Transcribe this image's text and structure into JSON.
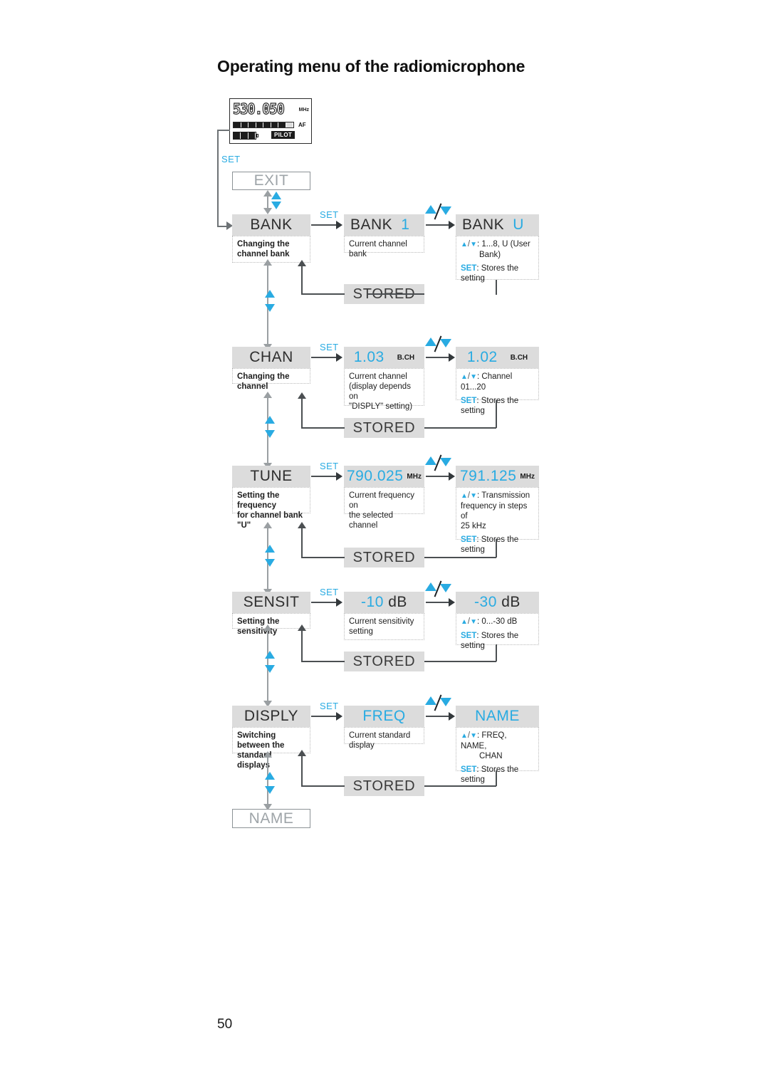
{
  "document": {
    "title": "Operating menu of the radiomicrophone",
    "page_number": "50"
  },
  "lcd": {
    "frequency": "530.050",
    "unit": "MHz",
    "af_label": "AF",
    "af_segments_on": 7,
    "af_segments_total": 8,
    "battery_segments_on": 3,
    "battery_segments_total": 3,
    "pilot_label": "PILOT"
  },
  "labels": {
    "set": "SET",
    "stored": "STORED",
    "exit": "EXIT",
    "name_bottom": "NAME"
  },
  "rows": [
    {
      "id": "bank",
      "menu_label": "BANK",
      "menu_desc": "Changing the channel bank",
      "value_label": "BANK",
      "value_number": "1",
      "value_desc": "Current channel bank",
      "edit_label": "BANK",
      "edit_number": "U",
      "edit_range_line1": ": 1...8, U (User",
      "edit_range_line2": "Bank)",
      "edit_set_label": "SET",
      "edit_set_text": ": Stores the setting",
      "stored": "STORED"
    },
    {
      "id": "chan",
      "menu_label": "CHAN",
      "menu_desc": "Changing the channel",
      "value_label": "1.03",
      "value_unit": "B.CH",
      "value_desc_l1": "Current channel",
      "value_desc_l2": "(display depends on",
      "value_desc_l3": "\"DISPLY\" setting)",
      "edit_label": "1.02",
      "edit_unit": "B.CH",
      "edit_range_line1": ": Channel  01...20",
      "edit_set_label": "SET",
      "edit_set_text": ": Stores the setting",
      "stored": "STORED"
    },
    {
      "id": "tune",
      "menu_label": "TUNE",
      "menu_desc_l1": "Setting the frequency",
      "menu_desc_l2": "for channel bank \"U\"",
      "value_label": "790.025",
      "value_unit": "MHz",
      "value_desc_l1": "Current frequency on",
      "value_desc_l2": "the selected channel",
      "edit_label": "791.125",
      "edit_unit": "MHz",
      "edit_range_line1": ": Transmission",
      "edit_range_line2": "frequency in steps of",
      "edit_range_line3": "25 kHz",
      "edit_set_label": "SET",
      "edit_set_text": ": Stores the setting",
      "stored": "STORED"
    },
    {
      "id": "sensit",
      "menu_label": "SENSIT",
      "menu_desc": "Setting the sensitivity",
      "value_number": "-10",
      "value_unit_text": " dB",
      "value_desc_l1": "Current sensitivity",
      "value_desc_l2": "setting",
      "edit_number": "-30",
      "edit_unit_text": " dB",
      "edit_range_line1": ": 0...-30 dB",
      "edit_set_label": "SET",
      "edit_set_text": ": Stores the setting",
      "stored": "STORED"
    },
    {
      "id": "disply",
      "menu_label": "DISPLY",
      "menu_desc_l1": "Switching between the",
      "menu_desc_l2": "standard displays",
      "value_label": "FREQ",
      "value_desc": "Current standard display",
      "edit_label": "NAME",
      "edit_range_line1": ": FREQ, NAME,",
      "edit_range_line2": "CHAN",
      "edit_set_label": "SET",
      "edit_set_text": ": Stores the setting",
      "stored": "STORED"
    }
  ],
  "colors": {
    "accent_blue": "#29ABE2",
    "box_gray": "#dcdcdc",
    "line_gray": "#4b4f52",
    "muted_text": "#9ea4a8"
  }
}
